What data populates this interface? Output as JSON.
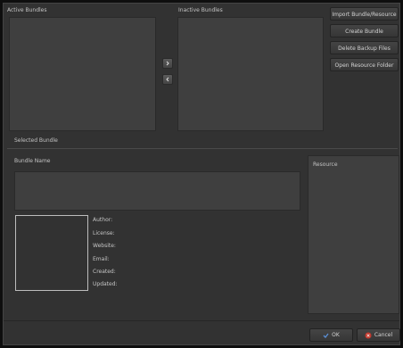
{
  "lists": {
    "active_label": "Active Bundles",
    "inactive_label": "Inactive Bundles"
  },
  "arrows": {
    "activate_icon": "chevron-right-icon",
    "deactivate_icon": "chevron-left-icon"
  },
  "actions": {
    "import_label": "Import Bundle/Resource",
    "create_label": "Create Bundle",
    "delete_label": "Delete Backup Files",
    "open_label": "Open Resource Folder"
  },
  "selected": {
    "group_label": "Selected Bundle",
    "bundle_name_label": "Bundle Name",
    "resource_label": "Resource",
    "fields": {
      "author": "Author:",
      "license": "License:",
      "website": "Website:",
      "email": "Email:",
      "created": "Created:",
      "updated": "Updated:"
    }
  },
  "footer": {
    "ok_label": "OK",
    "cancel_label": "Cancel",
    "ok_icon": "checkmark-icon",
    "cancel_icon": "cancel-icon",
    "ok_icon_color": "#5b8fd6",
    "cancel_icon_color": "#c43a2f"
  }
}
